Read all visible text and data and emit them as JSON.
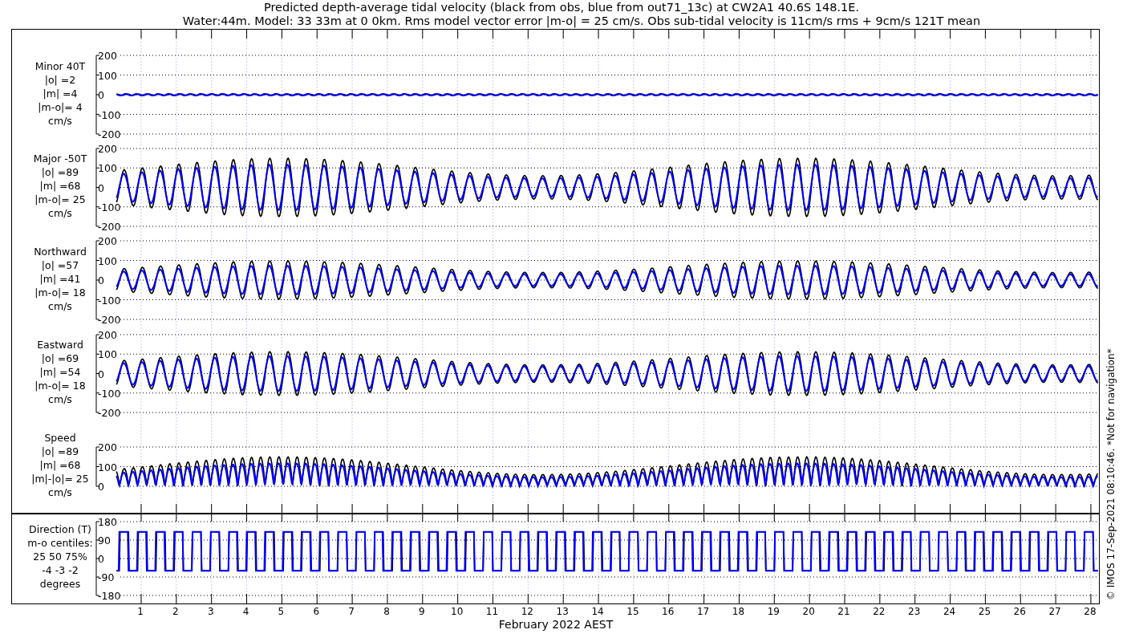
{
  "title": [
    "Predicted depth-average tidal velocity (black from obs, blue from out71_13c) at CW2A1 40.6S 148.1E.",
    "Water:44m. Model: 33 33m at 0 0km. Rms model vector error |m-o| = 25 cm/s. Obs sub-tidal velocity is 11cm/s rms + 9cm/s 121T mean"
  ],
  "panels": [
    {
      "kind": "minor",
      "label": [
        "Minor 40T",
        "|o| =2",
        "|m| =4",
        "|m-o|= 4",
        "cm/s"
      ],
      "yticks": [
        "200",
        "100",
        "0",
        "-100",
        "-200"
      ]
    },
    {
      "kind": "major",
      "label": [
        "Major -50T",
        "|o| =89",
        "|m| =68",
        "|m-o|= 25",
        "cm/s"
      ],
      "yticks": [
        "200",
        "100",
        "0",
        "-100",
        "-200"
      ]
    },
    {
      "kind": "north",
      "label": [
        "Northward",
        "|o| =57",
        "|m| =41",
        "|m-o|= 18",
        "cm/s"
      ],
      "yticks": [
        "200",
        "100",
        "0",
        "-100",
        "-200"
      ]
    },
    {
      "kind": "east",
      "label": [
        "Eastward",
        "|o| =69",
        "|m| =54",
        "|m-o|= 18",
        "cm/s"
      ],
      "yticks": [
        "200",
        "100",
        "0",
        "-100",
        "-200"
      ]
    },
    {
      "kind": "speed",
      "label": [
        "Speed",
        "|o| =89",
        "|m| =68",
        "|m|-|o|= 25",
        "cm/s"
      ],
      "yticks": [
        "200",
        "100",
        "0"
      ]
    },
    {
      "kind": "direction",
      "label": [
        "Direction (T)",
        "m-o centiles:",
        "25  50  75%",
        "-4 -3 -2",
        "degrees"
      ],
      "yticks": [
        "180",
        "90",
        "0",
        "-90",
        "-180"
      ]
    }
  ],
  "xticks": [
    "1",
    "2",
    "3",
    "4",
    "5",
    "6",
    "7",
    "8",
    "9",
    "10",
    "11",
    "12",
    "13",
    "14",
    "15",
    "16",
    "17",
    "18",
    "19",
    "20",
    "21",
    "22",
    "23",
    "24",
    "25",
    "26",
    "27",
    "28"
  ],
  "xlabel": "February 2022 AEST",
  "credit": "© IMOS 17-Sep-2021 08:10:46. *Not for navigation*"
}
